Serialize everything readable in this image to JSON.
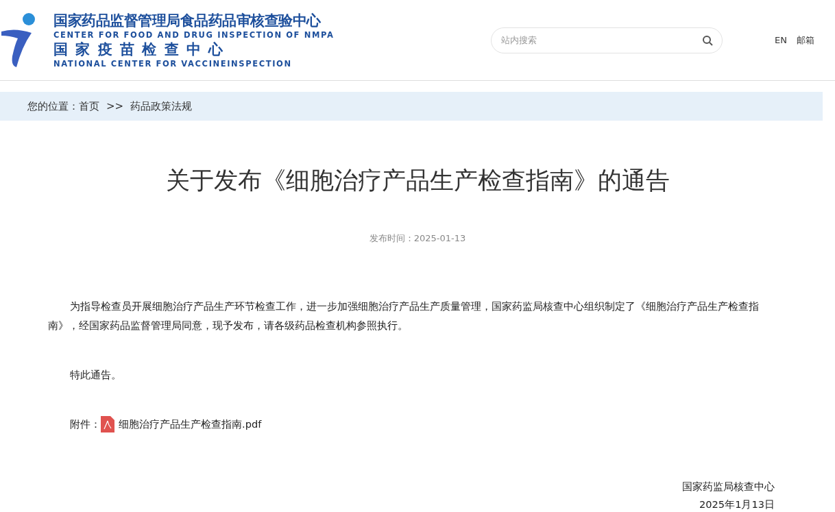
{
  "logo": {
    "title_cn": "国家药品监督管理局食品药品审核查验中心",
    "title_en": "CENTER FOR FOOD AND DRUG INSPECTION OF NMPA",
    "subtitle_cn": "国 家 疫 苗 检 查 中 心",
    "subtitle_en": "NATIONAL CENTER FOR VACCINEINSPECTION"
  },
  "search": {
    "placeholder": "站内搜索"
  },
  "top_links": [
    "EN",
    "邮箱"
  ],
  "breadcrumb": {
    "label": "您的位置：",
    "items": [
      "首页",
      "药品政策法规"
    ],
    "separator": ">>"
  },
  "article": {
    "title": "关于发布《细胞治疗产品生产检查指南》的通告",
    "date": "发布时间：2025-01-13",
    "paragraphs": [
      "为指导检查员开展细胞治疗产品生产环节检查工作，进一步加强细胞治疗产品生产质量管理，国家药监局核查中心组织制定了《细胞治疗产品生产检查指南》，经国家药品监督管理局同意，现予发布，请各级药品检查机构参照执行。",
      "特此通告。"
    ],
    "attachment": {
      "label": "附件：",
      "file": "细胞治疗产品生产检查指南.pdf"
    },
    "signature": [
      "国家药监局核查中心",
      "2025年1月13日"
    ]
  }
}
